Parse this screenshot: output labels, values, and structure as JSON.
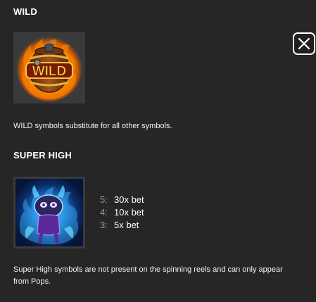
{
  "wild": {
    "title": "WILD",
    "symbol_text": "WILD",
    "symbol_icon": "wild-barrel-icon",
    "description": "WILD symbols substitute for all other symbols."
  },
  "super_high": {
    "title": "SUPER HIGH",
    "symbol_icon": "blue-creature-icon",
    "paytable": [
      {
        "count": "5:",
        "value": "30x bet"
      },
      {
        "count": "4:",
        "value": "10x bet"
      },
      {
        "count": "3:",
        "value": "5x bet"
      }
    ],
    "description": "Super High symbols are not present on the spinning reels and can only appear from Pops."
  },
  "close_icon": "close-icon",
  "colors": {
    "background": "#262626",
    "symbol_frame": "#3a3a3a",
    "wild_fire": "#f5a000",
    "super_high_glow": "#2aa8ff",
    "muted_text": "#9a9a9a"
  }
}
